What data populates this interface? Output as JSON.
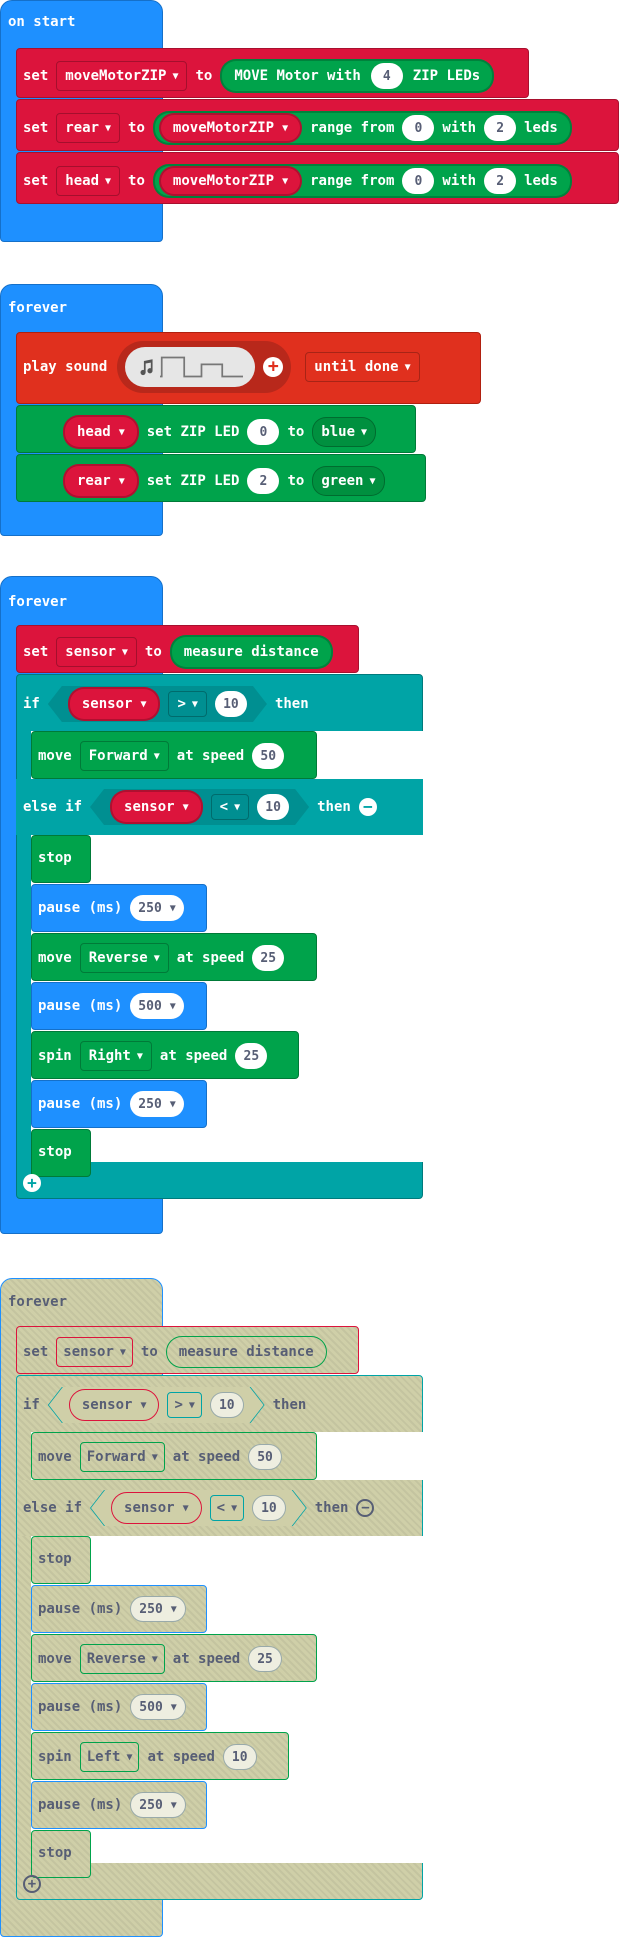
{
  "colors": {
    "events": "#1e90ff",
    "variables": "#dc143c",
    "zip": "#00a34b",
    "logic": "#00a4a6",
    "music": "#e0301e",
    "disabled": "#cfcfa8"
  },
  "onstart": {
    "title": "on start",
    "row1": {
      "set": "set",
      "var": "moveMotorZIP",
      "to": "to",
      "block": "MOVE Motor with",
      "count": "4",
      "suffix": "ZIP LEDs"
    },
    "row2": {
      "set": "set",
      "var": "rear",
      "to": "to",
      "src": "moveMotorZIP",
      "range": "range from",
      "from": "0",
      "with": "with",
      "n": "2",
      "leds": "leds"
    },
    "row3": {
      "set": "set",
      "var": "head",
      "to": "to",
      "src": "moveMotorZIP",
      "range": "range from",
      "from": "0",
      "with": "with",
      "n": "2",
      "leds": "leds"
    }
  },
  "forever1": {
    "title": "forever",
    "play": {
      "label": "play sound",
      "mode": "until done",
      "music_icon": "music-note-icon",
      "add_icon": "plus-icon"
    },
    "led1": {
      "var": "head",
      "label": "set ZIP LED",
      "index": "0",
      "to": "to",
      "color": "blue"
    },
    "led2": {
      "var": "rear",
      "label": "set ZIP LED",
      "index": "2",
      "to": "to",
      "color": "green"
    }
  },
  "forever2": {
    "title": "forever",
    "set": {
      "set": "set",
      "var": "sensor",
      "to": "to",
      "value": "measure distance"
    },
    "if": {
      "label": "if",
      "var": "sensor",
      "op": ">",
      "num": "10",
      "then": "then"
    },
    "move1": {
      "label": "move",
      "dir": "Forward",
      "speed_label": "at speed",
      "speed": "50"
    },
    "elseif": {
      "label": "else if",
      "var": "sensor",
      "op": "<",
      "num": "10",
      "then": "then"
    },
    "stop1": "stop",
    "p1": {
      "label": "pause (ms)",
      "value": "250"
    },
    "move2": {
      "label": "move",
      "dir": "Reverse",
      "speed_label": "at speed",
      "speed": "25"
    },
    "p2": {
      "label": "pause (ms)",
      "value": "500"
    },
    "spin": {
      "label": "spin",
      "dir": "Right",
      "speed_label": "at speed",
      "speed": "25"
    },
    "p3": {
      "label": "pause (ms)",
      "value": "250"
    },
    "stop2": "stop"
  },
  "forever3": {
    "title": "forever",
    "set": {
      "set": "set",
      "var": "sensor",
      "to": "to",
      "value": "measure distance"
    },
    "if": {
      "label": "if",
      "var": "sensor",
      "op": ">",
      "num": "10",
      "then": "then"
    },
    "move1": {
      "label": "move",
      "dir": "Forward",
      "speed_label": "at speed",
      "speed": "50"
    },
    "elseif": {
      "label": "else if",
      "var": "sensor",
      "op": "<",
      "num": "10",
      "then": "then"
    },
    "stop1": "stop",
    "p1": {
      "label": "pause (ms)",
      "value": "250"
    },
    "move2": {
      "label": "move",
      "dir": "Reverse",
      "speed_label": "at speed",
      "speed": "25"
    },
    "p2": {
      "label": "pause (ms)",
      "value": "500"
    },
    "spin": {
      "label": "spin",
      "dir": "Left",
      "speed_label": "at speed",
      "speed": "10"
    },
    "p3": {
      "label": "pause (ms)",
      "value": "250"
    },
    "stop2": "stop"
  }
}
